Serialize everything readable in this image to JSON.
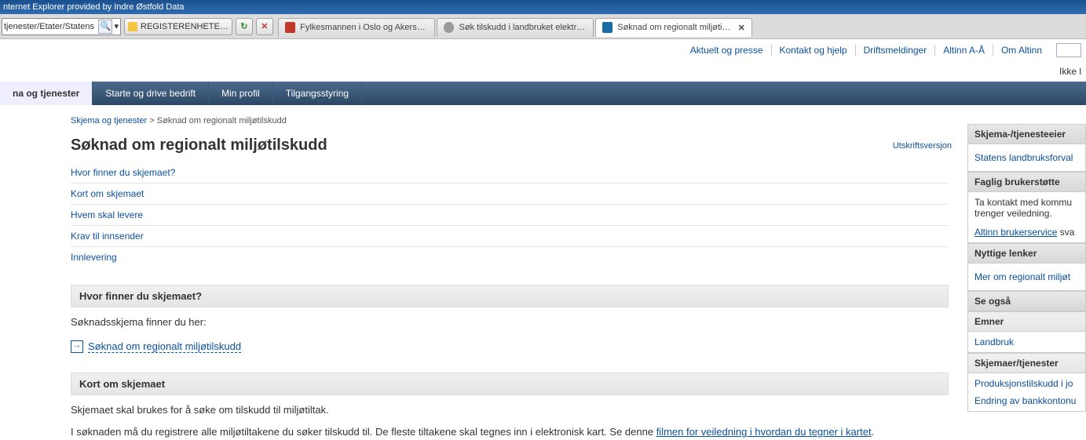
{
  "titlebar": {
    "text": "nternet Explorer provided by Indre Østfold Data"
  },
  "address": {
    "text": "tjenester/Etater/Statens"
  },
  "fav_btn": {
    "label": "REGISTERENHETE…"
  },
  "tabs": [
    {
      "label": "Fylkesmannen i Oslo og Akershu…"
    },
    {
      "label": "Søk tilskudd i landbruket elektro…"
    },
    {
      "label": "Søknad om regionalt miljøtils…"
    }
  ],
  "toplinks": {
    "l1": "Aktuelt og presse",
    "l2": "Kontakt og hjelp",
    "l3": "Driftsmeldinger",
    "l4": "Altinn A-Å",
    "l5": "Om Altinn"
  },
  "login": {
    "text": "Ikke l"
  },
  "nav": {
    "t1": "na og tjenester",
    "t2": "Starte og drive bedrift",
    "t3": "Min profil",
    "t4": "Tilgangsstyring"
  },
  "breadcrumb": {
    "a": "Skjema og tjenester",
    "sep": " > ",
    "cur": "Søknad om regionalt miljøtilskudd"
  },
  "page_title": "Søknad om regionalt miljøtilskudd",
  "print": "Utskriftsversjon",
  "anchors": {
    "a1": "Hvor finner du skjemaet?",
    "a2": "Kort om skjemaet",
    "a3": "Hvem skal levere",
    "a4": "Krav til innsender",
    "a5": "Innlevering"
  },
  "sec1": {
    "head": "Hvor finner du skjemaet?",
    "body": "Søknadsskjema finner du her:",
    "link": "Søknad om regionalt miljøtilskudd"
  },
  "sec2": {
    "head": "Kort om skjemaet",
    "p1": "Skjemaet skal brukes for å søke om tilskudd til miljøtiltak.",
    "p2a": "I søknaden må du registrere alle miljøtiltakene du søker tilskudd til. De fleste tiltakene skal tegnes inn i elektronisk kart. Se denne ",
    "p2link": "filmen for veiledning i hvordan du tegner i kartet",
    "p2b": "."
  },
  "side": {
    "h1": "Skjema-/tjenesteeier",
    "b1": "Statens landbruksforval",
    "h2": "Faglig brukerstøtte",
    "b2a": "Ta kontakt med kommu",
    "b2b": "trenger veiledning.",
    "b2link": "Altinn brukerservice",
    "b2c": " sva",
    "h3": "Nyttige lenker",
    "b3": "Mer om regionalt miljøt",
    "h4": "Se også",
    "h5": "Emner",
    "b5": "Landbruk",
    "h6": "Skjemaer/tjenester",
    "b6a": "Produksjonstilskudd i jo",
    "b6b": "Endring av bankkontonu"
  }
}
